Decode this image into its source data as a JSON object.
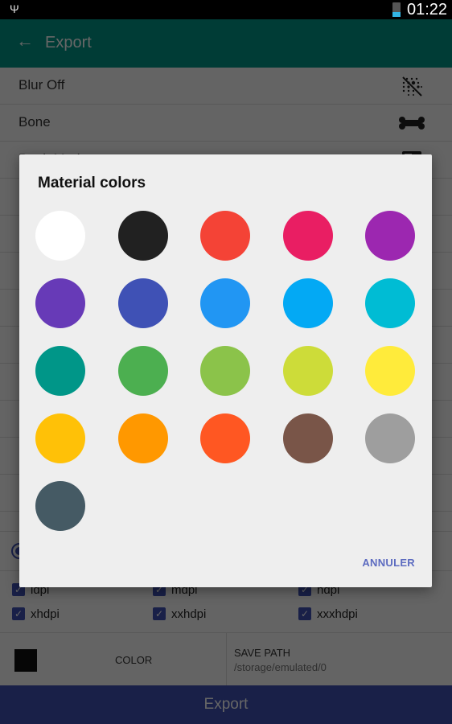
{
  "status_bar": {
    "usb_icon": "usb-icon",
    "battery_level": 0.35,
    "time": "01:22"
  },
  "app_bar": {
    "back_icon": "arrow-left-icon",
    "title": "Export"
  },
  "list": {
    "items": [
      {
        "label": "Blur Off",
        "icon": "blur-off-icon"
      },
      {
        "label": "Bone",
        "icon": "bone-icon"
      },
      {
        "label": "Book Mark",
        "icon": "bookmark-outline-icon"
      }
    ]
  },
  "densities": [
    {
      "label": "ldpi",
      "checked": true
    },
    {
      "label": "mdpi",
      "checked": true
    },
    {
      "label": "hdpi",
      "checked": true
    },
    {
      "label": "xhdpi",
      "checked": true
    },
    {
      "label": "xxhdpi",
      "checked": true
    },
    {
      "label": "xxxhdpi",
      "checked": true
    }
  ],
  "bottom_panel": {
    "color_swatch": "#111111",
    "color_label": "COLOR",
    "save_path_label": "SAVE PATH",
    "save_path_value": "/storage/emulated/0"
  },
  "export_button": "Export",
  "dialog": {
    "title": "Material colors",
    "colors": [
      {
        "name": "White",
        "hex": "#FFFFFF"
      },
      {
        "name": "Black",
        "hex": "#212121"
      },
      {
        "name": "Red",
        "hex": "#F44336"
      },
      {
        "name": "Pink",
        "hex": "#E91E63"
      },
      {
        "name": "Purple",
        "hex": "#9C27B0"
      },
      {
        "name": "Deep Purple",
        "hex": "#673AB7"
      },
      {
        "name": "Indigo",
        "hex": "#3F51B5"
      },
      {
        "name": "Blue",
        "hex": "#2196F3"
      },
      {
        "name": "Light Blue",
        "hex": "#03A9F4"
      },
      {
        "name": "Cyan",
        "hex": "#00BCD4"
      },
      {
        "name": "Teal",
        "hex": "#009688"
      },
      {
        "name": "Green",
        "hex": "#4CAF50"
      },
      {
        "name": "Light Green",
        "hex": "#8BC34A"
      },
      {
        "name": "Lime",
        "hex": "#CDDC39"
      },
      {
        "name": "Yellow",
        "hex": "#FFEB3B"
      },
      {
        "name": "Amber",
        "hex": "#FFC107"
      },
      {
        "name": "Orange",
        "hex": "#FF9800"
      },
      {
        "name": "Deep Orange",
        "hex": "#FF5722"
      },
      {
        "name": "Brown",
        "hex": "#795548"
      },
      {
        "name": "Grey",
        "hex": "#9E9E9E"
      },
      {
        "name": "Blue Grey",
        "hex": "#455A64"
      }
    ],
    "cancel_label": "ANNULER"
  }
}
